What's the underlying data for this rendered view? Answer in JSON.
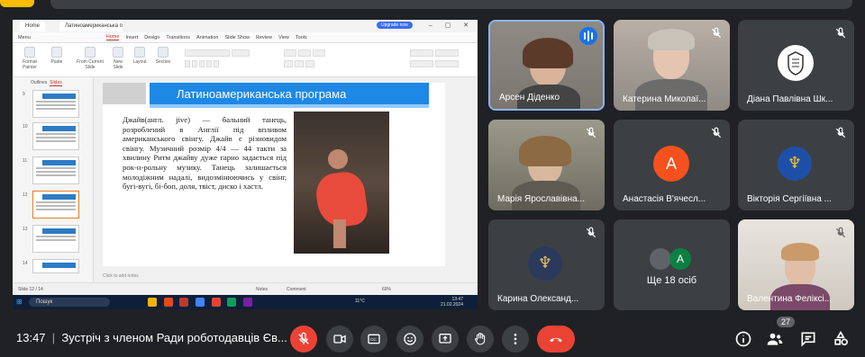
{
  "meeting": {
    "time": "13:47",
    "title": "Зустріч з членом Ради роботодавців Єв..."
  },
  "share": {
    "tabs": [
      "Home",
      "Латиноамериканська програма"
    ],
    "upgrade_label": "Upgrade now",
    "menu": [
      "Menu",
      "Home",
      "Insert",
      "Design",
      "Transitions",
      "Animation",
      "Slide Show",
      "Review",
      "View",
      "Tools"
    ],
    "ribbon_buttons": [
      "Format Painter",
      "Paste",
      "From Current Slide",
      "New Slide",
      "Layout",
      "Section"
    ],
    "thumb_tabs": [
      "Outlines",
      "Slides"
    ],
    "thumb_numbers": [
      "9",
      "10",
      "11",
      "12",
      "13",
      "14"
    ],
    "slide_title": "Латиноамериканська програма",
    "slide_body": "Джайв(англ. jive) — бальний танець, розроблений в Англії під впливом американського свінгу. Джайв є різновидом свінгу. Музичний розмір 4/4 — 44 такти за хвилину Ритм джайву дуже гарно задається під рок-н-рольну музику. Танець залишається молодіжним надалі, видозмінюючись у свінг, бугі-вугі, бі-боп, доля, твіст, диско і хастл.",
    "notes_placeholder": "Click to add notes",
    "status_left": "Slide 12 / 14",
    "status_notes": "Notes",
    "status_comment": "Comment",
    "zoom": "69%",
    "taskbar_search": "Пошук",
    "taskbar_weather": "11°C",
    "taskbar_time": "13:47",
    "taskbar_date": "21.02.2024"
  },
  "participants": [
    {
      "name": "Арсен Діденко",
      "type": "photo",
      "speaking": true
    },
    {
      "name": "Катерина Миколаї...",
      "type": "photo",
      "muted": true
    },
    {
      "name": "Діана Павлівна Шк...",
      "type": "crest",
      "muted": true
    },
    {
      "name": "Марія Ярославівна...",
      "type": "photo",
      "muted": true
    },
    {
      "name": "Анастасія В'ячесл...",
      "type": "letter",
      "letter": "А",
      "color": "#f4511e",
      "muted": true
    },
    {
      "name": "Вікторія Сергіївна ...",
      "type": "trident",
      "muted": true
    },
    {
      "name": "Карина Олександ...",
      "type": "trident-dark",
      "muted": true
    },
    {
      "name": "Ще 18 осіб",
      "type": "more",
      "letter": "A"
    },
    {
      "name": "Валентина Феліксі...",
      "type": "photo",
      "muted": true
    }
  ],
  "participants_count": "27",
  "icons": [
    "mic-off-icon",
    "camera-icon",
    "captions-icon",
    "emoji-icon",
    "present-icon",
    "raise-hand-icon",
    "more-icon",
    "end-call-icon",
    "info-icon",
    "people-icon",
    "chat-icon",
    "activities-icon"
  ]
}
